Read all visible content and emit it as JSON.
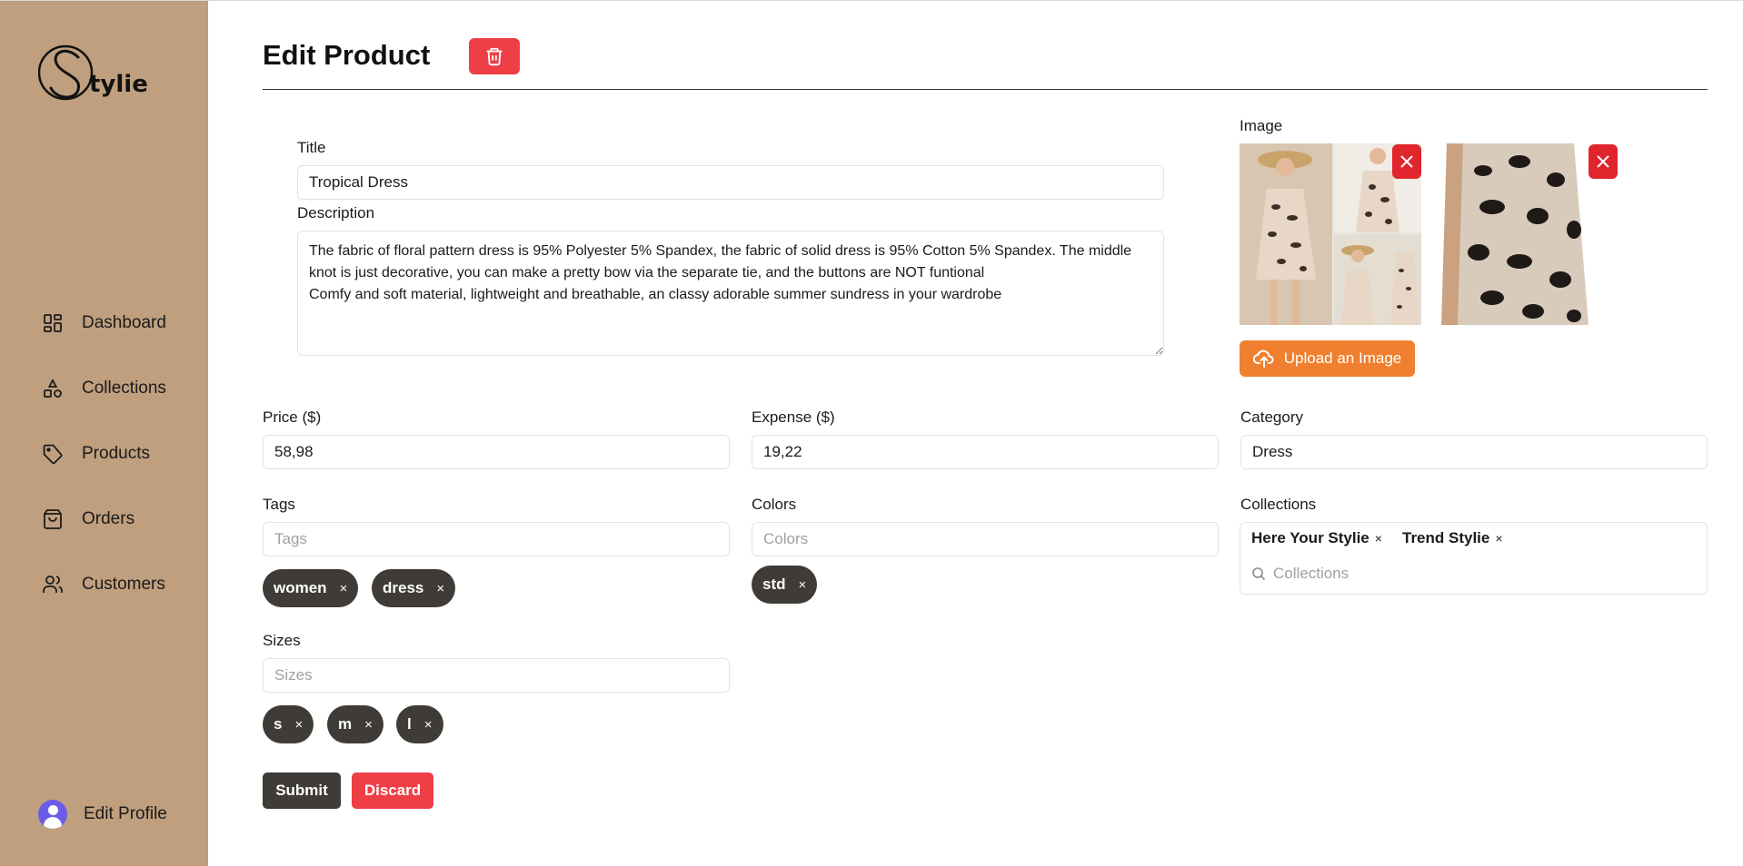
{
  "brand": {
    "logo_text": "tylie"
  },
  "sidebar": {
    "items": [
      {
        "label": "Dashboard",
        "icon": "dashboard-icon"
      },
      {
        "label": "Collections",
        "icon": "shapes-icon"
      },
      {
        "label": "Products",
        "icon": "tag-icon"
      },
      {
        "label": "Orders",
        "icon": "shopping-bag-icon"
      },
      {
        "label": "Customers",
        "icon": "users-icon"
      }
    ],
    "profile_label": "Edit Profile"
  },
  "header": {
    "title": "Edit Product"
  },
  "form": {
    "title_label": "Title",
    "title_value": "Tropical Dress",
    "description_label": "Description",
    "description_value": "The fabric of floral pattern dress is 95% Polyester 5% Spandex, the fabric of solid dress is 95% Cotton 5% Spandex. The middle knot is just decorative, you can make a pretty bow via the separate tie, and the buttons are NOT funtional\nComfy and soft material, lightweight and breathable, an classy adorable summer sundress in your wardrobe",
    "image_label": "Image",
    "upload_label": "Upload an Image",
    "price_label": "Price ($)",
    "price_value": "58,98",
    "expense_label": "Expense ($)",
    "expense_value": "19,22",
    "category_label": "Category",
    "category_value": "Dress",
    "tags_label": "Tags",
    "tags_placeholder": "Tags",
    "tags": [
      "women",
      "dress"
    ],
    "colors_label": "Colors",
    "colors_placeholder": "Colors",
    "colors": [
      "std"
    ],
    "collections_label": "Collections",
    "collections_placeholder": "Collections",
    "collections": [
      "Here Your Stylie",
      "Trend Stylie"
    ],
    "sizes_label": "Sizes",
    "sizes_placeholder": "Sizes",
    "sizes": [
      "s",
      "m",
      "l"
    ],
    "remove_symbol": "×",
    "submit_label": "Submit",
    "discard_label": "Discard"
  },
  "colors": {
    "sidebar_bg": "#bf9f7e",
    "danger": "#ef3f46",
    "upload": "#f0802f",
    "chip": "#3f3c38",
    "avatar": "#6b5ce7"
  }
}
